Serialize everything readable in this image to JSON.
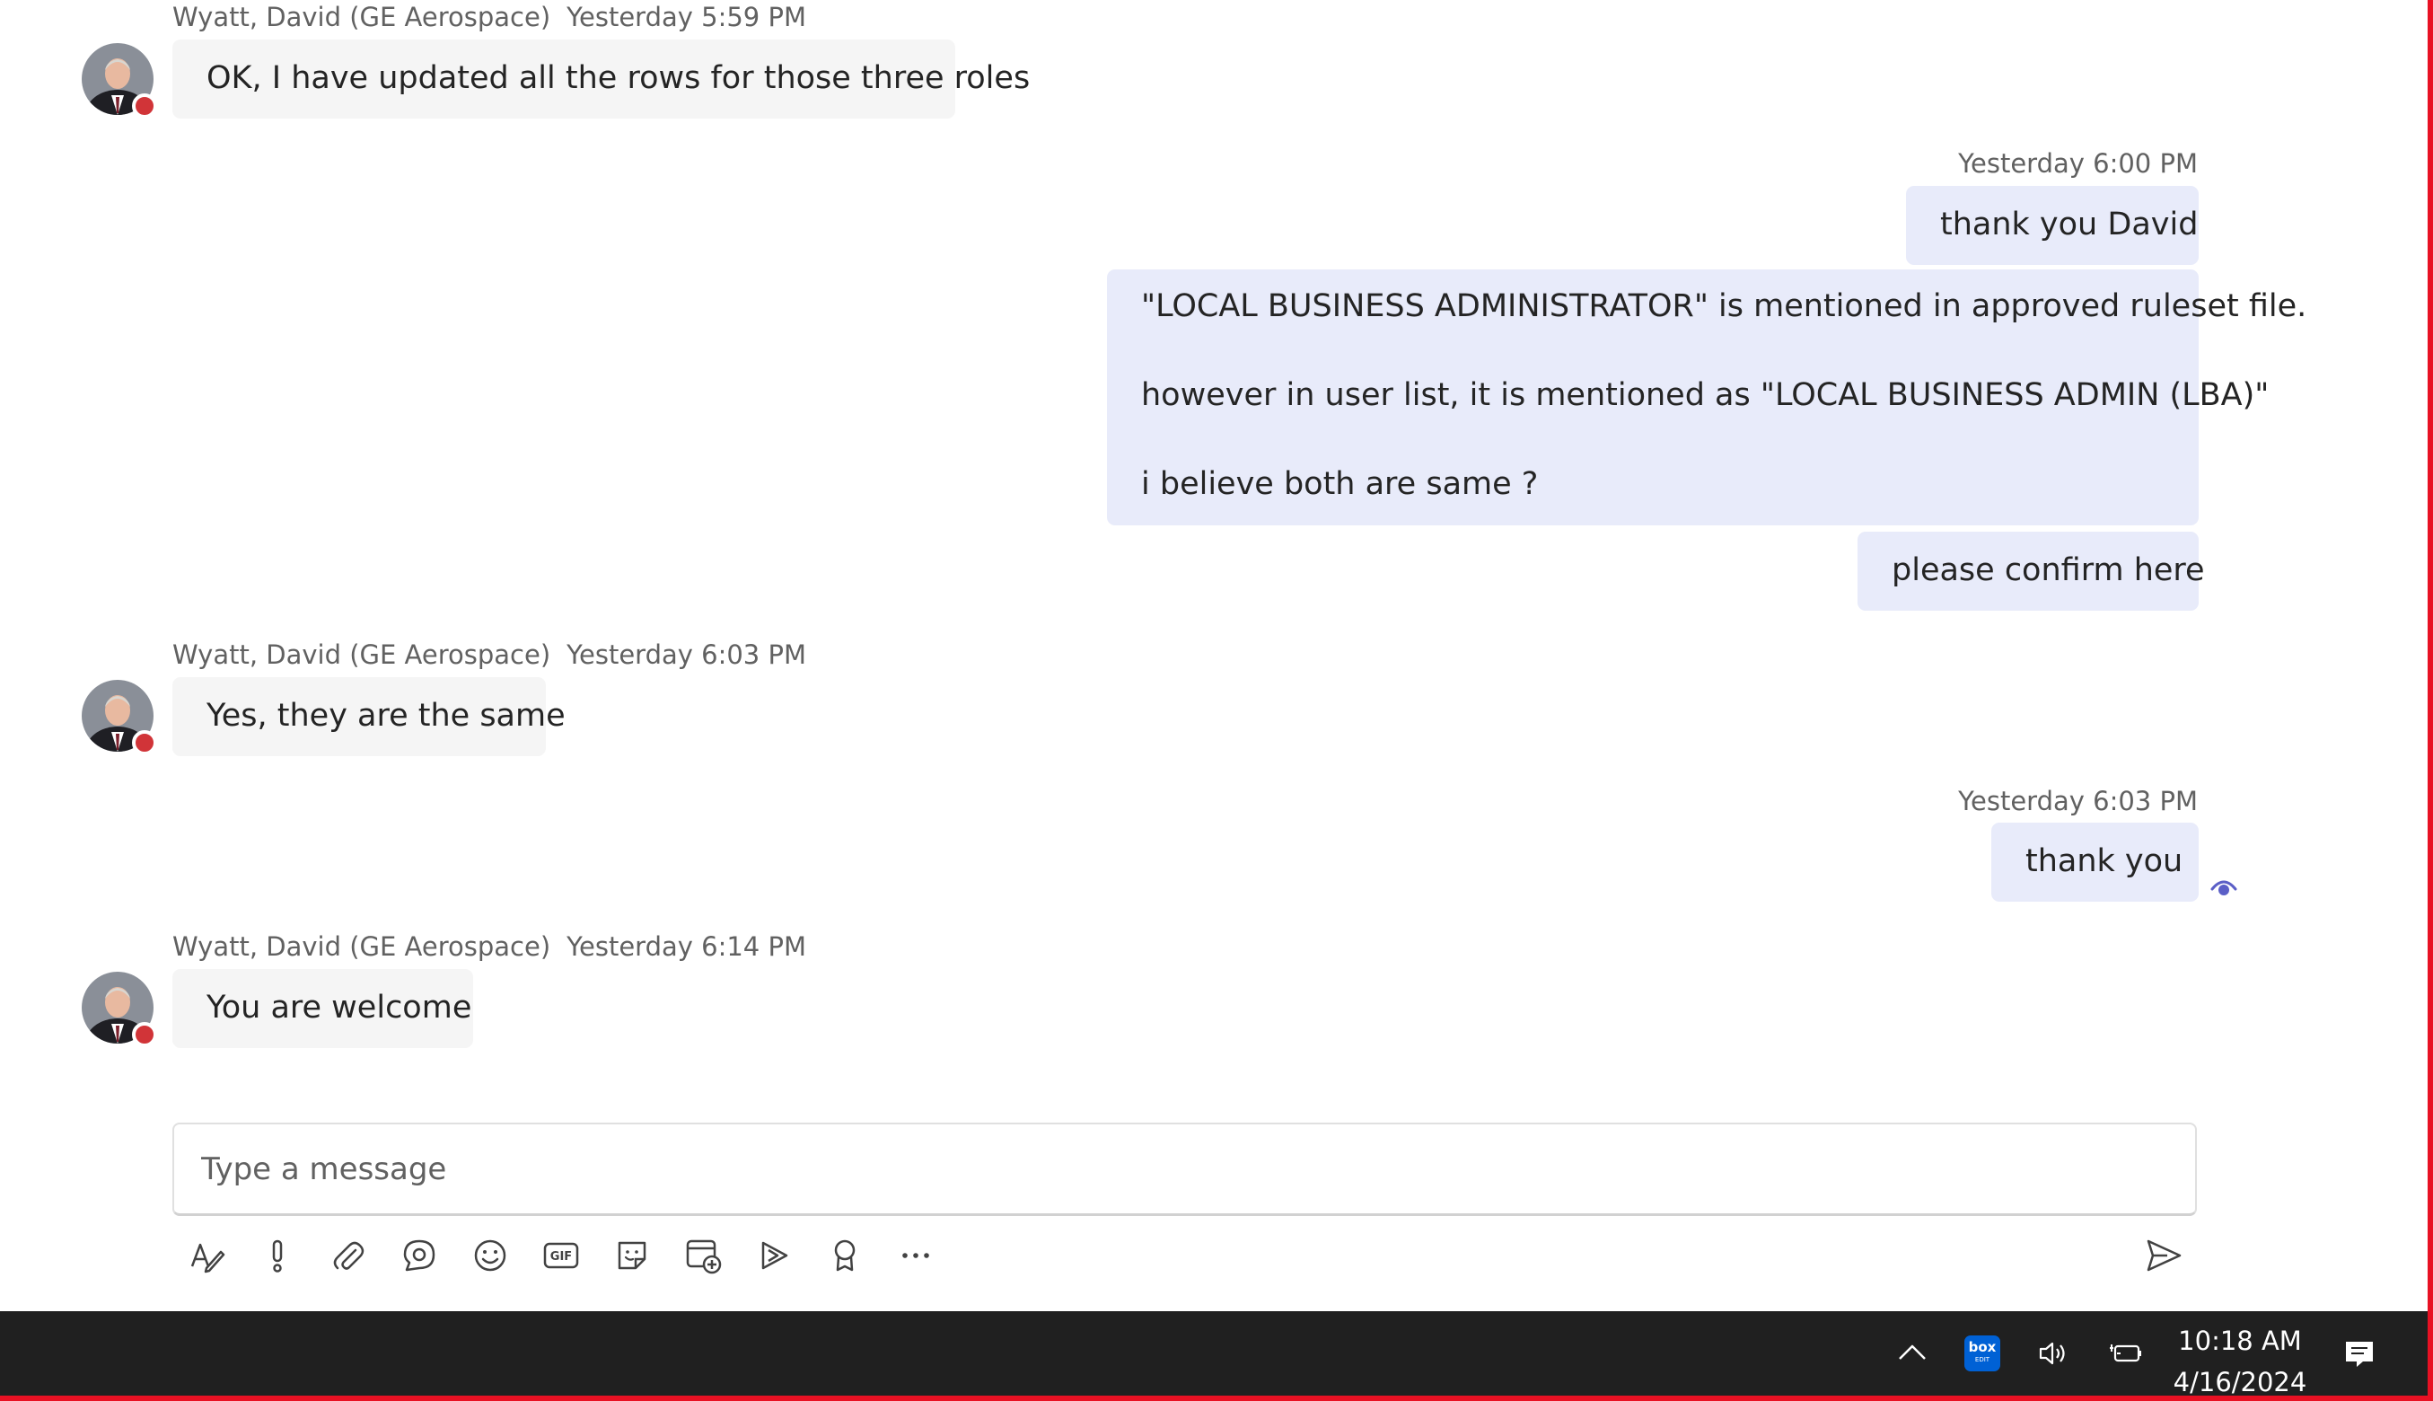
{
  "messages": [
    {
      "sender": "Wyatt, David (GE Aerospace)",
      "time": "Yesterday 5:59 PM",
      "lines": [
        "OK, I have updated all the rows for those three roles"
      ]
    },
    {
      "time": "Yesterday 6:00 PM",
      "lines": [
        "thank you David"
      ]
    },
    {
      "lines": [
        "\"LOCAL BUSINESS ADMINISTRATOR\" is mentioned in approved ruleset file.",
        "however in user list, it is mentioned as \"LOCAL BUSINESS ADMIN (LBA)\"",
        "i believe both are same ?"
      ]
    },
    {
      "lines": [
        "please confirm here"
      ]
    },
    {
      "sender": "Wyatt, David (GE Aerospace)",
      "time": "Yesterday 6:03 PM",
      "lines": [
        "Yes, they are the same"
      ]
    },
    {
      "time": "Yesterday 6:03 PM",
      "lines": [
        "thank you"
      ]
    },
    {
      "sender": "Wyatt, David (GE Aerospace)",
      "time": "Yesterday 6:14 PM",
      "lines": [
        "You are welcome"
      ]
    }
  ],
  "compose": {
    "placeholder": "Type a message"
  },
  "toolbar_icons": [
    "format-icon",
    "important-icon",
    "attach-icon",
    "loop-icon",
    "emoji-icon",
    "gif-icon",
    "sticker-icon",
    "schedule-meeting-icon",
    "stream-icon",
    "praise-icon",
    "more-options-icon",
    "send-icon"
  ],
  "taskbar": {
    "box_label": "box",
    "box_sub": "EDIT",
    "time": "10:18 AM",
    "date": "4/16/2024"
  },
  "colors": {
    "incoming_bubble": "#f5f5f5",
    "outgoing_bubble": "#e8ebfa",
    "presence_busy": "#d13438",
    "accent": "#5b5fc7",
    "taskbar": "#202020"
  }
}
